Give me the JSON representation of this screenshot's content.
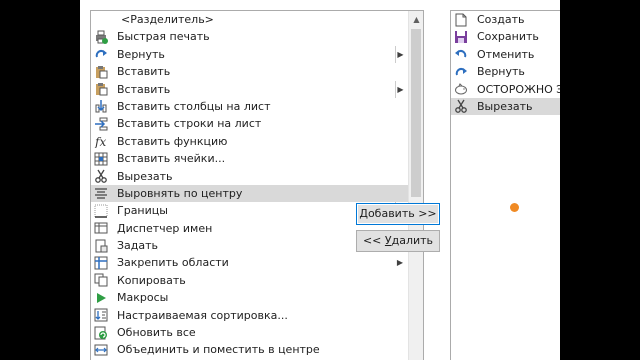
{
  "available_commands": {
    "items": [
      {
        "label": "<Разделитель>",
        "icon": "separator"
      },
      {
        "label": "Быстрая печать",
        "icon": "quick-print-icon"
      },
      {
        "label": "Вернуть",
        "icon": "redo-icon",
        "submenu": true,
        "boxed_arrow": true
      },
      {
        "label": "Вставить",
        "icon": "paste-icon"
      },
      {
        "label": "Вставить",
        "icon": "paste-options-icon",
        "submenu": true,
        "boxed_arrow": true
      },
      {
        "label": "Вставить столбцы на лист",
        "icon": "insert-columns-icon"
      },
      {
        "label": "Вставить строки на лист",
        "icon": "insert-rows-icon"
      },
      {
        "label": "Вставить функцию",
        "icon": "function-icon"
      },
      {
        "label": "Вставить ячейки...",
        "icon": "insert-cells-icon"
      },
      {
        "label": "Вырезать",
        "icon": "scissors-icon"
      },
      {
        "label": "Выровнять по центру",
        "icon": "align-center-icon",
        "selected": true
      },
      {
        "label": "Границы",
        "icon": "borders-icon",
        "submenu": true,
        "boxed_arrow": true
      },
      {
        "label": "Диспетчер имен",
        "icon": "name-manager-icon"
      },
      {
        "label": "Задать",
        "icon": "set-print-area-icon"
      },
      {
        "label": "Закрепить области",
        "icon": "freeze-panes-icon",
        "submenu": true
      },
      {
        "label": "Копировать",
        "icon": "copy-icon"
      },
      {
        "label": "Макросы",
        "icon": "macros-icon"
      },
      {
        "label": "Настраиваемая сортировка...",
        "icon": "custom-sort-icon"
      },
      {
        "label": "Обновить все",
        "icon": "refresh-all-icon"
      },
      {
        "label": "Объединить и поместить в центре",
        "icon": "merge-center-icon"
      }
    ]
  },
  "buttons": {
    "add": {
      "pre": "",
      "underlined": "Д",
      "post": "обавить >>"
    },
    "remove": {
      "pre": "<< ",
      "underlined": "У",
      "post": "далить"
    }
  },
  "toolbar_commands": {
    "items": [
      {
        "label": "Создать",
        "icon": "new-file-icon"
      },
      {
        "label": "Сохранить",
        "icon": "save-icon"
      },
      {
        "label": "Отменить",
        "icon": "undo-icon"
      },
      {
        "label": "Вернуть",
        "icon": "redo-icon"
      },
      {
        "label": "ОСТОРОЖНО ЭТ",
        "icon": "piggy-bank-icon"
      },
      {
        "label": "Вырезать",
        "icon": "scissors-icon",
        "selected": true
      }
    ]
  },
  "colors": {
    "accent": "#0078d7",
    "selection": "#d9d9d9",
    "marker": "#f08a24"
  }
}
